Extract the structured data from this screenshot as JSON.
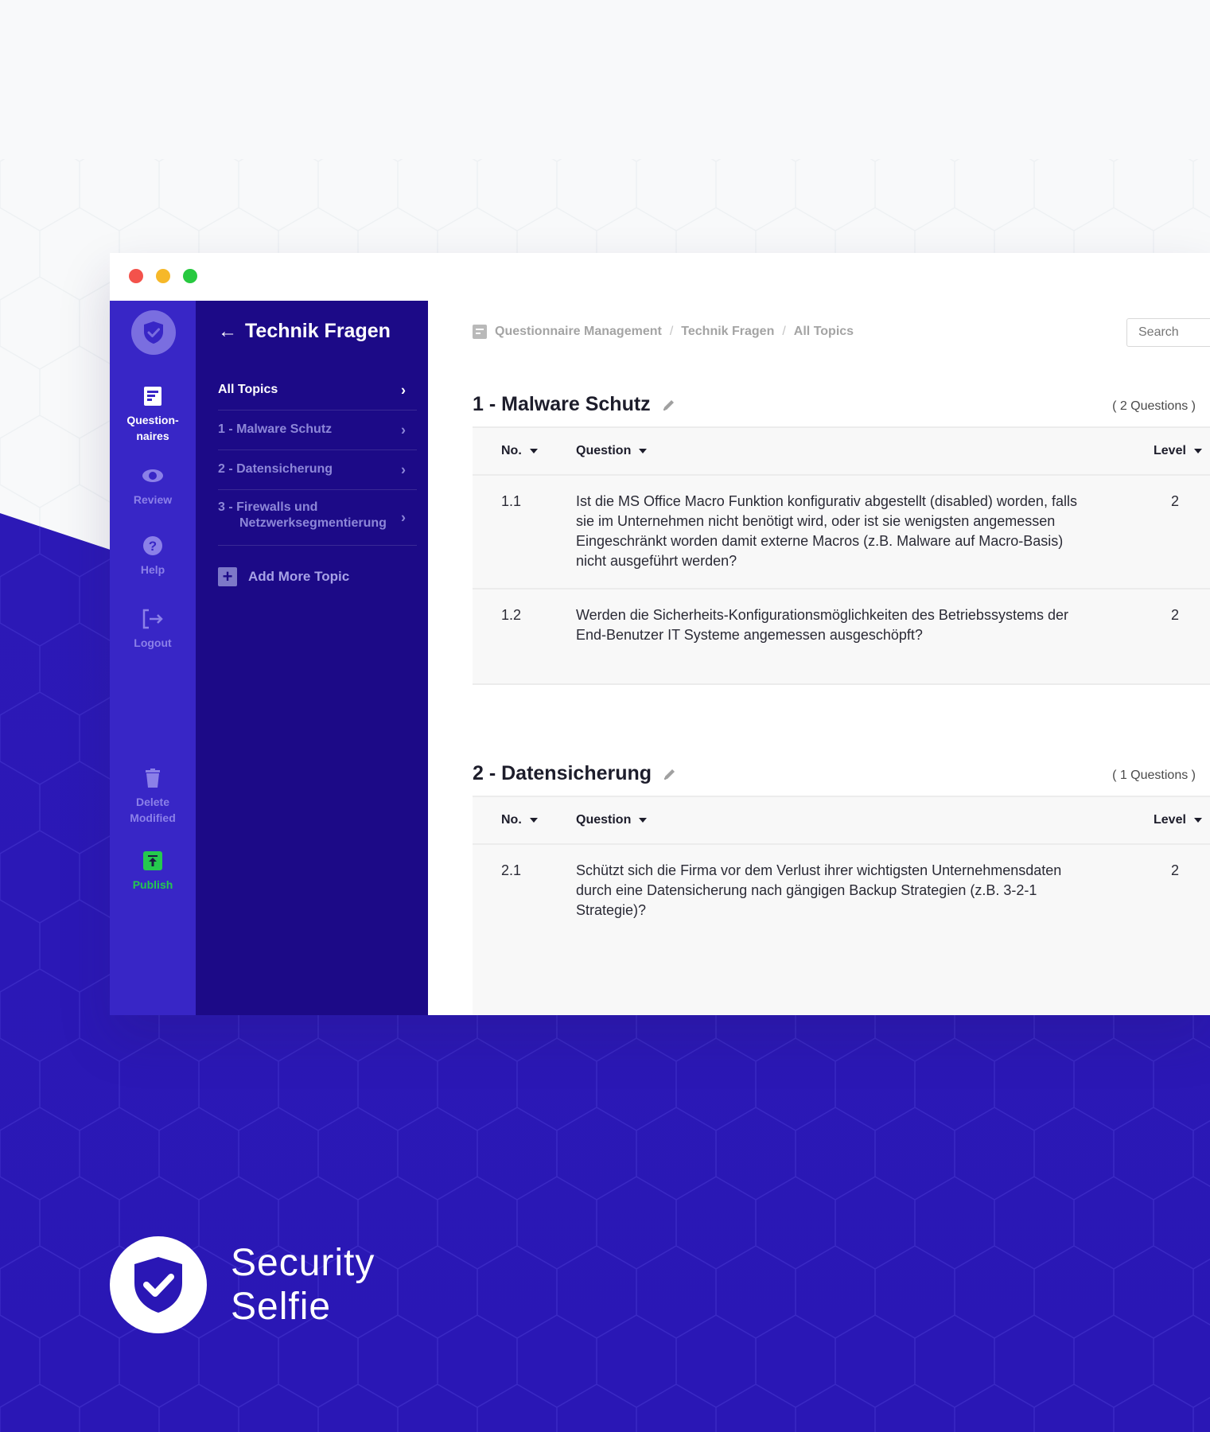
{
  "window": {
    "rail": {
      "items": [
        {
          "label": "Question-\nnaires",
          "icon": "questionnaires-icon"
        },
        {
          "label": "Review",
          "icon": "eye-icon"
        },
        {
          "label": "Help",
          "icon": "help-icon"
        },
        {
          "label": "Logout",
          "icon": "logout-icon"
        },
        {
          "label": "Delete\nModified",
          "icon": "trash-icon"
        },
        {
          "label": "Publish",
          "icon": "publish-icon"
        }
      ]
    },
    "topics": {
      "title": "Technik Fragen",
      "items": [
        {
          "label": "All Topics"
        },
        {
          "label": "1 - Malware Schutz"
        },
        {
          "label": "2 - Datensicherung"
        },
        {
          "label": "3 - Firewalls und Netzwerksegmentierung"
        }
      ],
      "add_label": "Add More Topic"
    },
    "breadcrumb": [
      "Questionnaire Management",
      "Technik Fragen",
      "All Topics"
    ],
    "search": {
      "placeholder": "Search"
    },
    "table_headers": {
      "no": "No.",
      "question": "Question",
      "level": "Level"
    },
    "sections": [
      {
        "title": "1 - Malware Schutz",
        "count": "( 2 Questions )",
        "rows": [
          {
            "no": "1.1",
            "question": "Ist die MS Office Macro Funktion konfigurativ abgestellt (disabled) worden, falls sie im Unternehmen nicht benötigt wird, oder ist sie wenigsten angemessen Eingeschränkt worden damit externe Macros (z.B. Malware auf Macro-Basis) nicht ausgeführt werden?",
            "level": "2"
          },
          {
            "no": "1.2",
            "question": "Werden die Sicherheits-Konfigurationsmöglichkeiten des Betriebssystems der End-Benutzer IT Systeme angemessen ausgeschöpft?",
            "level": "2"
          }
        ]
      },
      {
        "title": "2 - Datensicherung",
        "count": "( 1 Questions )",
        "rows": [
          {
            "no": "2.1",
            "question": "Schützt sich die Firma vor dem Verlust ihrer wichtigsten Unternehmensdaten durch eine Datensicherung nach gängigen Backup Strategien (z.B. 3-2-1 Strategie)?",
            "level": "2"
          }
        ]
      }
    ]
  },
  "brand": {
    "line1": "Security",
    "line2": "Selfie"
  },
  "colors": {
    "rail": "#3826c6",
    "topics": "#1c0a87",
    "publish": "#25c94e",
    "background": "#2a17b5"
  }
}
